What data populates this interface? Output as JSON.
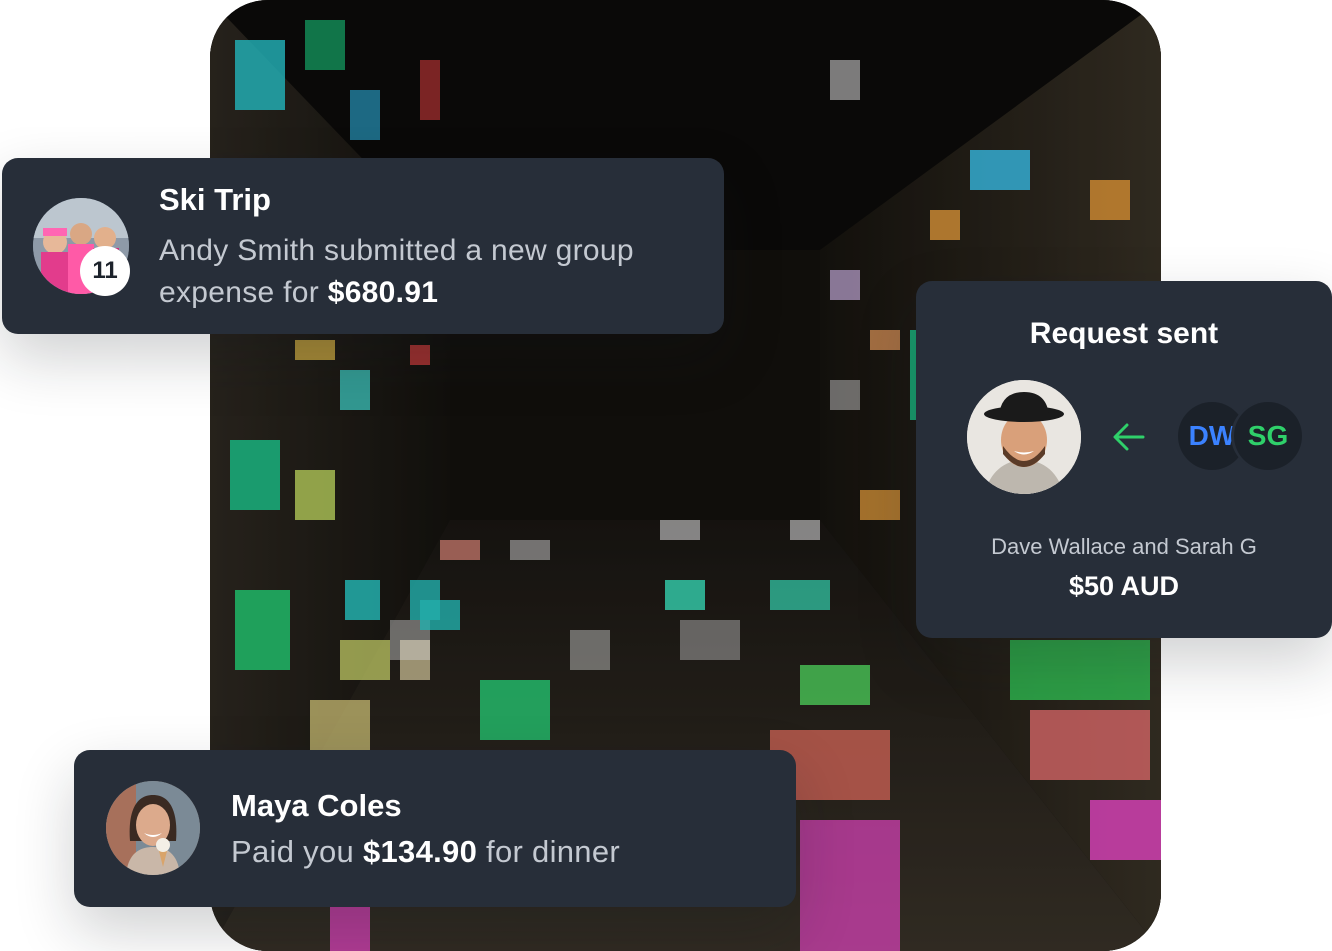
{
  "background": {
    "image": "night-building-courtyard-colorful-windows"
  },
  "ski_trip": {
    "title": "Ski Trip",
    "badge_count": "11",
    "message_prefix": "Andy Smith submitted a new group expense for ",
    "amount": "$680.91"
  },
  "request": {
    "title": "Request sent",
    "initials_1": "DW",
    "initials_2": "SG",
    "names": "Dave Wallace and Sarah G",
    "amount": "$50 AUD",
    "arrow_icon": "arrow-left-icon",
    "colors": {
      "arrow": "#2fd06a",
      "dw": "#3b82ff",
      "sg": "#2fd06a"
    }
  },
  "maya": {
    "title": "Maya Coles",
    "prefix": "Paid you ",
    "amount": "$134.90",
    "suffix": " for dinner"
  }
}
